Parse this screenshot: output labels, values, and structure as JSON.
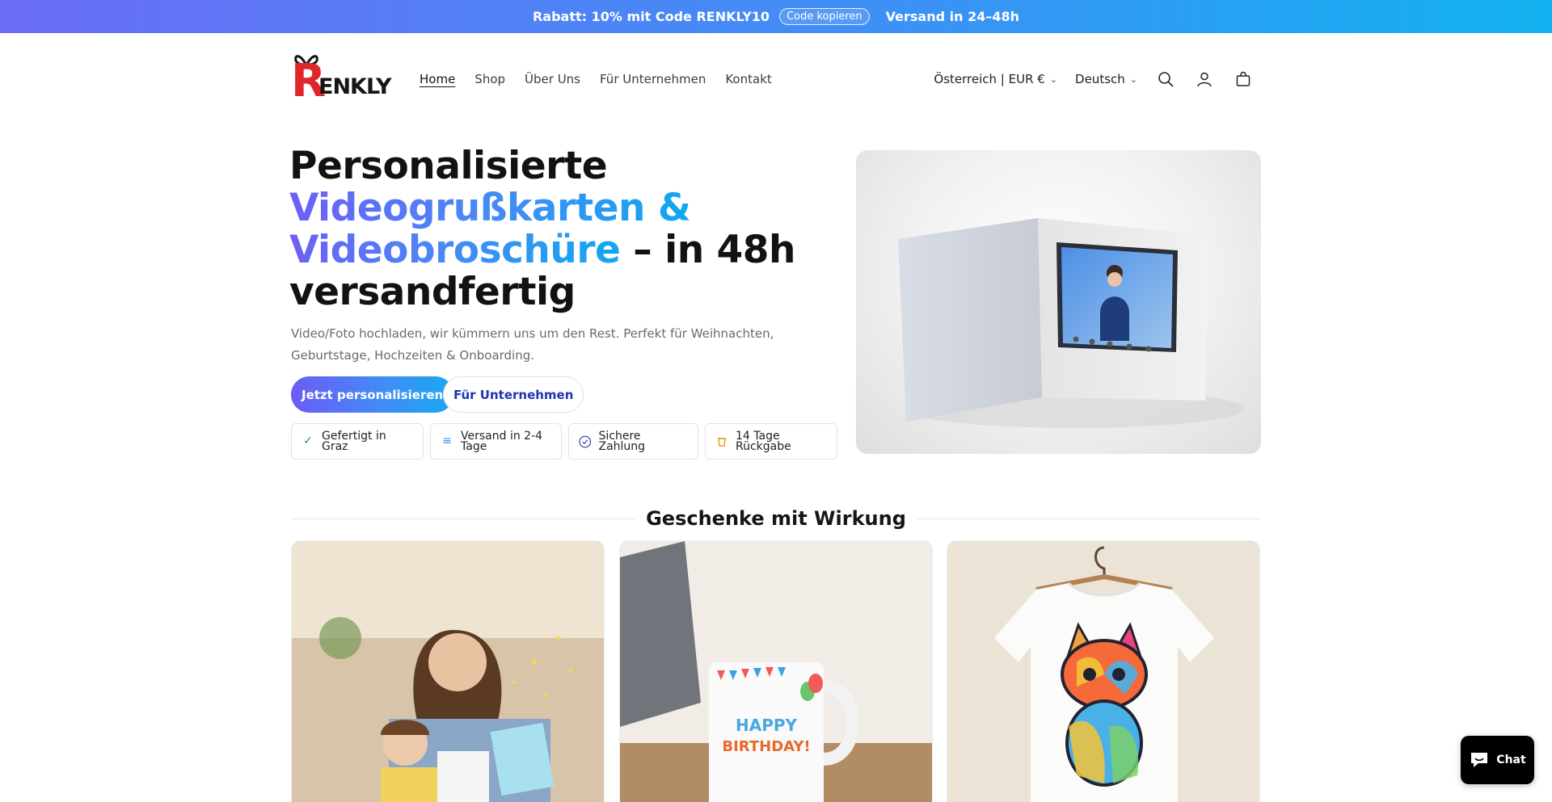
{
  "announcement": {
    "discount_text": "Rabatt: 10% mit Code RENKLY10",
    "copy_button": "Code kopieren",
    "shipping_text": "Versand in 24–48h"
  },
  "header": {
    "logo_text": "RENKLY",
    "nav": [
      {
        "label": "Home",
        "active": true
      },
      {
        "label": "Shop"
      },
      {
        "label": "Über Uns"
      },
      {
        "label": "Für Unternehmen"
      },
      {
        "label": "Kontakt"
      }
    ],
    "country_selector": "Österreich | EUR €",
    "language_selector": "Deutsch",
    "icons": [
      "search-icon",
      "account-icon",
      "cart-icon"
    ]
  },
  "hero": {
    "title_line1": "Personalisierte",
    "title_grad1": "Videogrußkarten &",
    "title_grad2": "Videobroschüre",
    "title_rest": " – in 48h",
    "title_line4": "versandfertig",
    "subtitle": "Video/Foto hochladen, wir kümmern uns um den Rest. Perfekt für Weihnachten, Geburtstage, Hochzeiten & Onboarding.",
    "primary_button": "Jetzt personalisieren",
    "secondary_button": "Für Unternehmen",
    "badges": [
      {
        "line1": "Gefertigt in",
        "line2": "Graz",
        "icon": "check-icon",
        "color": "#2e8b57"
      },
      {
        "line1": "Versand in 2-4",
        "line2": "Tage",
        "icon": "menu-lines-icon",
        "color": "#3f8ff5"
      },
      {
        "line1": "Sichere Zahlung",
        "line2": "",
        "icon": "shield-check-icon",
        "color": "#4a4aa8"
      },
      {
        "line1": "14 Tage",
        "line2": "Rückgabe",
        "icon": "return-box-icon",
        "color": "#e0a020"
      }
    ]
  },
  "section": {
    "title": "Geschenke mit Wirkung"
  },
  "cards": [
    {
      "name": "mother-daughter-card-image"
    },
    {
      "name": "birthday-mug-image",
      "mug_text1": "HAPPY",
      "mug_text2": "BIRTHDAY!"
    },
    {
      "name": "cat-tshirt-image"
    }
  ],
  "chat": {
    "label": "Chat"
  },
  "colors": {
    "brand_red": "#e0252b",
    "gradient_start": "#6b6cf5",
    "gradient_end": "#12b1f0",
    "secondary_button_text": "#1e35b5"
  }
}
